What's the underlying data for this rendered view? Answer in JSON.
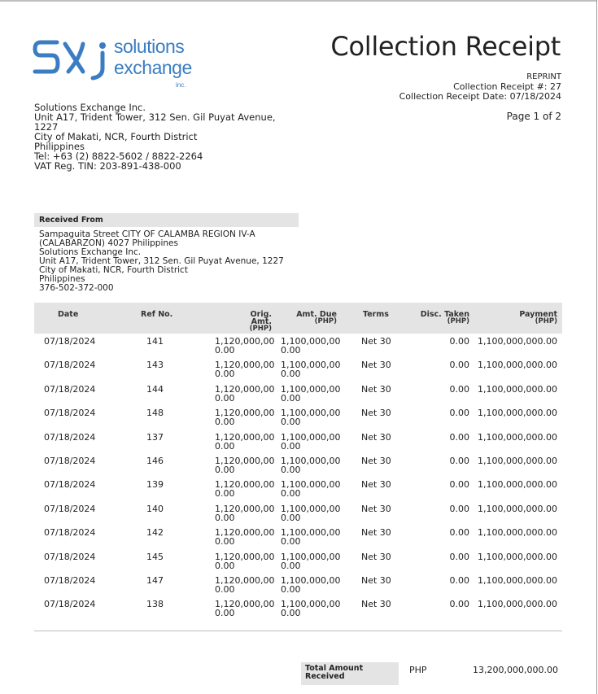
{
  "logo": {
    "mark_text": "SXi",
    "word1": "solutions",
    "word2": "exchange",
    "inc": "inc."
  },
  "document": {
    "title": "Collection Receipt",
    "reprint": "REPRINT",
    "receipt_no": "Collection Receipt #: 27",
    "receipt_date": "Collection Receipt Date: 07/18/2024",
    "page": "Page 1 of 2"
  },
  "company": {
    "lines": [
      "Solutions Exchange Inc.",
      "Unit A17, Trident Tower, 312 Sen. Gil Puyat Avenue,",
      "1227",
      "City of Makati, NCR, Fourth District",
      "Philippines",
      "Tel: +63 (2) 8822-5602 / 8822-2264",
      "VAT Reg. TIN: 203-891-438-000"
    ]
  },
  "received_from": {
    "heading": "Received From",
    "lines": [
      "Sampaguita Street CITY OF CALAMBA REGION IV-A",
      "(CALABARZON) 4027 Philippines",
      "Solutions Exchange Inc.",
      "Unit A17, Trident Tower, 312 Sen. Gil Puyat Avenue, 1227",
      "City of Makati, NCR, Fourth District",
      "Philippines",
      "376-502-372-000"
    ]
  },
  "table": {
    "headers": {
      "date": "Date",
      "ref": "Ref No.",
      "orig": "Orig. Amt.",
      "orig_unit": "(PHP)",
      "due": "Amt. Due",
      "due_unit": "(PHP)",
      "terms": "Terms",
      "disc": "Disc. Taken",
      "disc_unit": "(PHP)",
      "payment": "Payment",
      "payment_unit": "(PHP)"
    },
    "rows": [
      {
        "date": "07/18/2024",
        "ref": "141",
        "orig": "1,120,000,00",
        "orig2": "0.00",
        "due": "1,100,000,00",
        "due2": "0.00",
        "terms": "Net 30",
        "disc": "0.00",
        "payment": "1,100,000,000.00"
      },
      {
        "date": "07/18/2024",
        "ref": "143",
        "orig": "1,120,000,00",
        "orig2": "0.00",
        "due": "1,100,000,00",
        "due2": "0.00",
        "terms": "Net 30",
        "disc": "0.00",
        "payment": "1,100,000,000.00"
      },
      {
        "date": "07/18/2024",
        "ref": "144",
        "orig": "1,120,000,00",
        "orig2": "0.00",
        "due": "1,100,000,00",
        "due2": "0.00",
        "terms": "Net 30",
        "disc": "0.00",
        "payment": "1,100,000,000.00"
      },
      {
        "date": "07/18/2024",
        "ref": "148",
        "orig": "1,120,000,00",
        "orig2": "0.00",
        "due": "1,100,000,00",
        "due2": "0.00",
        "terms": "Net 30",
        "disc": "0.00",
        "payment": "1,100,000,000.00"
      },
      {
        "date": "07/18/2024",
        "ref": "137",
        "orig": "1,120,000,00",
        "orig2": "0.00",
        "due": "1,100,000,00",
        "due2": "0.00",
        "terms": "Net 30",
        "disc": "0.00",
        "payment": "1,100,000,000.00"
      },
      {
        "date": "07/18/2024",
        "ref": "146",
        "orig": "1,120,000,00",
        "orig2": "0.00",
        "due": "1,100,000,00",
        "due2": "0.00",
        "terms": "Net 30",
        "disc": "0.00",
        "payment": "1,100,000,000.00"
      },
      {
        "date": "07/18/2024",
        "ref": "139",
        "orig": "1,120,000,00",
        "orig2": "0.00",
        "due": "1,100,000,00",
        "due2": "0.00",
        "terms": "Net 30",
        "disc": "0.00",
        "payment": "1,100,000,000.00"
      },
      {
        "date": "07/18/2024",
        "ref": "140",
        "orig": "1,120,000,00",
        "orig2": "0.00",
        "due": "1,100,000,00",
        "due2": "0.00",
        "terms": "Net 30",
        "disc": "0.00",
        "payment": "1,100,000,000.00"
      },
      {
        "date": "07/18/2024",
        "ref": "142",
        "orig": "1,120,000,00",
        "orig2": "0.00",
        "due": "1,100,000,00",
        "due2": "0.00",
        "terms": "Net 30",
        "disc": "0.00",
        "payment": "1,100,000,000.00"
      },
      {
        "date": "07/18/2024",
        "ref": "145",
        "orig": "1,120,000,00",
        "orig2": "0.00",
        "due": "1,100,000,00",
        "due2": "0.00",
        "terms": "Net 30",
        "disc": "0.00",
        "payment": "1,100,000,000.00"
      },
      {
        "date": "07/18/2024",
        "ref": "147",
        "orig": "1,120,000,00",
        "orig2": "0.00",
        "due": "1,100,000,00",
        "due2": "0.00",
        "terms": "Net 30",
        "disc": "0.00",
        "payment": "1,100,000,000.00"
      },
      {
        "date": "07/18/2024",
        "ref": "138",
        "orig": "1,120,000,00",
        "orig2": "0.00",
        "due": "1,100,000,00",
        "due2": "0.00",
        "terms": "Net 30",
        "disc": "0.00",
        "payment": "1,100,000,000.00"
      }
    ]
  },
  "total": {
    "label_line1": "Total Amount",
    "label_line2": "Received",
    "currency": "PHP",
    "value": "13,200,000,000.00"
  },
  "colors": {
    "logo_blue": "#3a7dc2",
    "header_gray": "#e4e4e4"
  }
}
